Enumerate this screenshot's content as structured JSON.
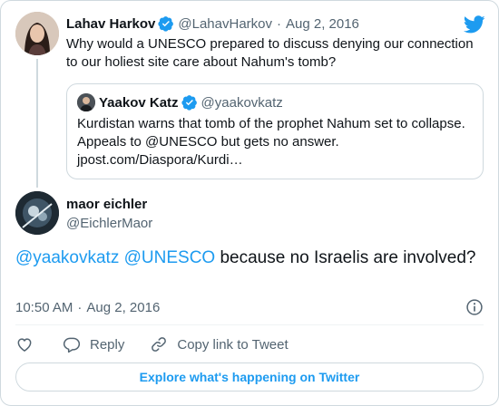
{
  "parent_tweet": {
    "author_name": "Lahav Harkov",
    "author_handle": "@LahavHarkov",
    "separator": "·",
    "date": "Aug 2, 2016",
    "text_lines": [
      "Why would a UNESCO prepared to discuss denying our connection",
      "to our holiest site care about Nahum's tomb?"
    ]
  },
  "quoted_tweet": {
    "author_name": "Yaakov Katz",
    "author_handle": "@yaakovkatz",
    "text_lines": [
      "Kurdistan warns that tomb of the prophet Nahum set to collapse.",
      "Appeals to @UNESCO but gets no answer.",
      "jpost.com/Diaspora/Kurdi…"
    ]
  },
  "reply_tweet": {
    "author_name": "maor eichler",
    "author_handle": "@EichlerMaor",
    "mention_1": "@yaakovkatz",
    "mention_2": "@UNESCO",
    "text_rest": " because no Israelis are involved?",
    "time": "10:50 AM",
    "separator": "·",
    "date": "Aug 2, 2016"
  },
  "actions": {
    "reply_label": "Reply",
    "copy_link_label": "Copy link to Tweet"
  },
  "explore_label": "Explore what's happening on Twitter",
  "icons": {
    "brand": "twitter-bird-icon",
    "verified": "verified-badge-icon",
    "like": "heart-icon",
    "reply": "speech-bubble-icon",
    "copy": "link-icon",
    "info": "info-icon"
  },
  "colors": {
    "brand_blue": "#1d9bf0",
    "text_primary": "#0f1419",
    "text_secondary": "#536471",
    "border": "#cfd9de"
  }
}
